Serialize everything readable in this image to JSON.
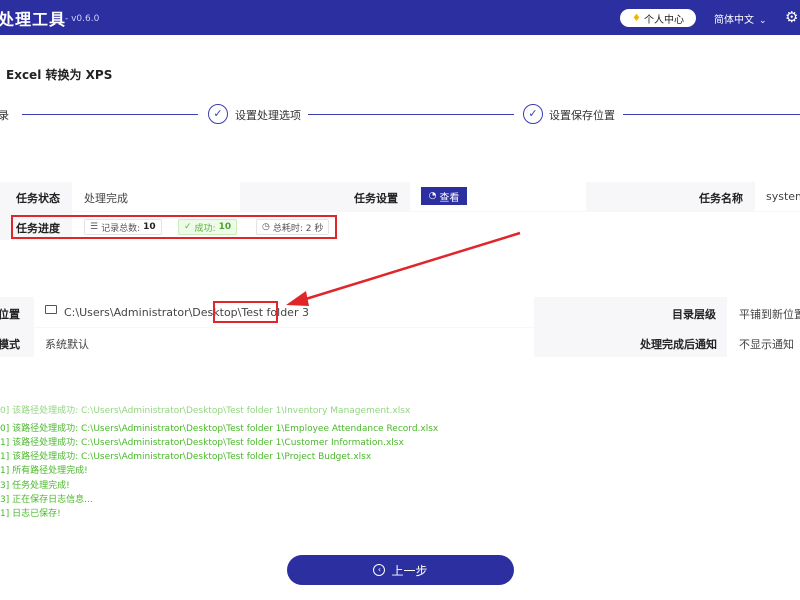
{
  "header": {
    "app_title": "处理工具",
    "version": "- v0.6.0",
    "personal_center": "个人中心",
    "language": "简体中文"
  },
  "page": {
    "title": "Excel 转换为 XPS"
  },
  "steps": [
    {
      "label": "录"
    },
    {
      "label": "设置处理选项"
    },
    {
      "label": "设置保存位置"
    }
  ],
  "task": {
    "status_label": "任务状态",
    "status_value": "处理完成",
    "settings_label": "任务设置",
    "view_button": "查看",
    "name_label": "任务名称",
    "name_value": "system",
    "progress_label": "任务进度",
    "total_label": "记录总数:",
    "total_value": "10",
    "success_label": "成功:",
    "success_value": "10",
    "time_label": "总耗时: 2 秒"
  },
  "output": {
    "location_label": "位置",
    "path_prefix": "C:\\Users\\Administrator\\Desktop\\",
    "path_folder": "Test folder 3",
    "dir_level_label": "目录层级",
    "dir_level_value": "平铺到新位置",
    "mode_label": "模式",
    "mode_value": "系统默认",
    "notify_label": "处理完成后通知",
    "notify_value": "不显示通知"
  },
  "log": [
    "0] 该路径处理成功: C:\\Users\\Administrator\\Desktop\\Test folder 1\\Inventory Management.xlsx",
    "0] 该路径处理成功: C:\\Users\\Administrator\\Desktop\\Test folder 1\\Employee Attendance Record.xlsx",
    "1] 该路径处理成功: C:\\Users\\Administrator\\Desktop\\Test folder 1\\Customer Information.xlsx",
    "1] 该路径处理成功: C:\\Users\\Administrator\\Desktop\\Test folder 1\\Project Budget.xlsx",
    "1] 所有路径处理完成!",
    "3] 任务处理完成!",
    "3] 正在保存日志信息...",
    "1] 日志已保存!"
  ],
  "footer": {
    "prev_button": "上一步"
  },
  "colors": {
    "brand": "#2b2fa0",
    "highlight": "#e0262a",
    "log_green": "#49b82a"
  }
}
